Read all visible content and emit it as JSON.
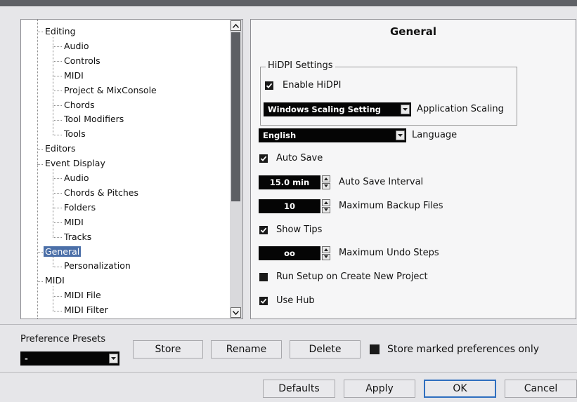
{
  "tree": [
    {
      "label": "Editing",
      "level": 1
    },
    {
      "label": "Audio",
      "level": 2
    },
    {
      "label": "Controls",
      "level": 2
    },
    {
      "label": "MIDI",
      "level": 2
    },
    {
      "label": "Project & MixConsole",
      "level": 2
    },
    {
      "label": "Chords",
      "level": 2
    },
    {
      "label": "Tool Modifiers",
      "level": 2
    },
    {
      "label": "Tools",
      "level": 2
    },
    {
      "label": "Editors",
      "level": 1
    },
    {
      "label": "Event Display",
      "level": 1
    },
    {
      "label": "Audio",
      "level": 2
    },
    {
      "label": "Chords & Pitches",
      "level": 2
    },
    {
      "label": "Folders",
      "level": 2
    },
    {
      "label": "MIDI",
      "level": 2
    },
    {
      "label": "Tracks",
      "level": 2
    },
    {
      "label": "General",
      "level": 1,
      "selected": true
    },
    {
      "label": "Personalization",
      "level": 2
    },
    {
      "label": "MIDI",
      "level": 1
    },
    {
      "label": "MIDI File",
      "level": 2
    },
    {
      "label": "MIDI Filter",
      "level": 2
    }
  ],
  "panel": {
    "title": "General",
    "hidpi_group": "HiDPI Settings",
    "enable_hidpi": {
      "label": "Enable HiDPI",
      "checked": true
    },
    "app_scaling": {
      "value": "Windows Scaling Setting",
      "label": "Application Scaling"
    },
    "language": {
      "value": "English",
      "label": "Language"
    },
    "auto_save": {
      "label": "Auto Save",
      "checked": true
    },
    "auto_save_interval": {
      "value": "15.0 min",
      "label": "Auto Save Interval"
    },
    "max_backup": {
      "value": "10",
      "label": "Maximum Backup Files"
    },
    "show_tips": {
      "label": "Show Tips",
      "checked": true
    },
    "max_undo": {
      "value": "oo",
      "label": "Maximum Undo Steps"
    },
    "run_setup": {
      "label": "Run Setup on Create New Project",
      "checked": false
    },
    "use_hub": {
      "label": "Use Hub",
      "checked": true
    }
  },
  "presets": {
    "label": "Preference Presets",
    "value": "-",
    "store": "Store",
    "rename": "Rename",
    "delete": "Delete",
    "store_marked": {
      "label": "Store marked preferences only",
      "checked": false
    }
  },
  "footer": {
    "defaults": "Defaults",
    "apply": "Apply",
    "ok": "OK",
    "cancel": "Cancel"
  },
  "colors": {
    "selection": "#4b6fa8",
    "field_bg": "#050505",
    "default_button_border": "#2f6fbf"
  }
}
